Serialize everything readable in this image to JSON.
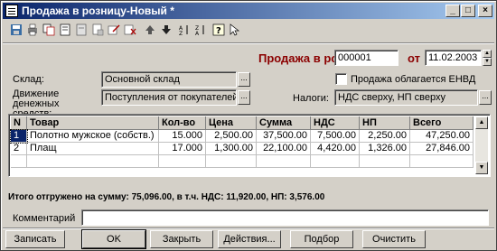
{
  "window": {
    "title": "Продажа в розницу-Новый *"
  },
  "colors": {
    "title_start": "#0a246a",
    "title_end": "#a6caf0",
    "doc_title": "#8b0000"
  },
  "toolbar": {
    "icons": [
      "save-icon",
      "print-icon",
      "copy-icon",
      "doc-icon",
      "doc2-icon",
      "doc3-icon",
      "edit-icon",
      "delete-icon",
      "up-arrow-icon",
      "down-arrow-icon",
      "sort-asc-icon",
      "sort-desc-icon",
      "help-icon",
      "pointer-icon"
    ]
  },
  "doc": {
    "title_label": "Продажа в розницу №",
    "number": "000001",
    "date_label": "от",
    "date": "11.02.2003"
  },
  "form": {
    "warehouse_label": "Склад:",
    "warehouse_value": "Основной склад",
    "cash_move_label": "Движение денежных средств:",
    "cash_move_value": "Поступления от покупателей",
    "envd_label": "Продажа облагается ЕНВД",
    "taxes_label": "Налоги:",
    "taxes_value": "НДС сверху, НП сверху"
  },
  "table": {
    "columns": [
      "N",
      "Товар",
      "Кол-во",
      "Цена",
      "Сумма",
      "НДС",
      "НП",
      "Всего"
    ],
    "rows": [
      [
        "1",
        "Полотно мужское (собств.)",
        "15.000",
        "2,500.00",
        "37,500.00",
        "7,500.00",
        "2,250.00",
        "47,250.00"
      ],
      [
        "2",
        "Плащ",
        "17.000",
        "1,300.00",
        "22,100.00",
        "4,420.00",
        "1,326.00",
        "27,846.00"
      ]
    ]
  },
  "totals": "Итого отгружено на сумму: 75,096.00, в т.ч. НДС: 11,920.00, НП: 3,576.00",
  "comment": {
    "label": "Комментарий",
    "value": ""
  },
  "buttons": {
    "record": "Записать",
    "ok": "OK",
    "close": "Закрыть",
    "actions": "Действия...",
    "select": "Подбор",
    "clear": "Очистить"
  }
}
